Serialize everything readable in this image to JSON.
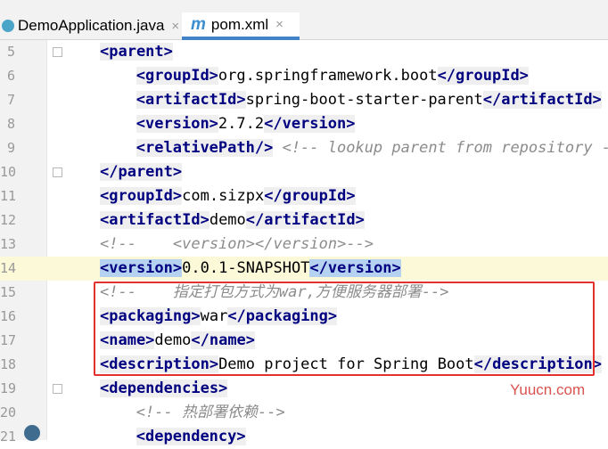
{
  "tabs": [
    {
      "label": "DemoApplication.java",
      "icon": "java-class-icon"
    },
    {
      "label": "pom.xml",
      "icon": "maven-icon",
      "active": true
    }
  ],
  "tab_close_glyph": "×",
  "maven_glyph": "m",
  "lines": [
    {
      "n": "5",
      "code": [
        [
          "t",
          "<parent>"
        ]
      ]
    },
    {
      "n": "6",
      "code": [
        [
          "t",
          "<groupId>"
        ],
        [
          "p",
          "org.springframework.boot"
        ],
        [
          "t",
          "</groupId>"
        ]
      ]
    },
    {
      "n": "7",
      "code": [
        [
          "t",
          "<artifactId>"
        ],
        [
          "p",
          "spring-boot-starter-parent"
        ],
        [
          "t",
          "</artifactId>"
        ]
      ]
    },
    {
      "n": "8",
      "code": [
        [
          "t",
          "<version>"
        ],
        [
          "p",
          "2.7.2"
        ],
        [
          "t",
          "</version>"
        ]
      ]
    },
    {
      "n": "9",
      "code": [
        [
          "t",
          "<relativePath/>"
        ],
        [
          "p",
          " "
        ],
        [
          "c",
          "<!-- lookup parent from repository -->"
        ]
      ]
    },
    {
      "n": "10",
      "code": [
        [
          "t",
          "</parent>"
        ]
      ]
    },
    {
      "n": "11",
      "code": [
        [
          "t",
          "<groupId>"
        ],
        [
          "p",
          "com.sizpx"
        ],
        [
          "t",
          "</groupId>"
        ]
      ]
    },
    {
      "n": "12",
      "code": [
        [
          "t",
          "<artifactId>"
        ],
        [
          "p",
          "demo"
        ],
        [
          "t",
          "</artifactId>"
        ]
      ]
    },
    {
      "n": "13",
      "code": [
        [
          "c",
          "<!--    <version></version>-->"
        ]
      ]
    },
    {
      "n": "14",
      "code": [
        [
          "t",
          "<version>"
        ],
        [
          "p",
          "0.0.1-SNAPSHOT"
        ],
        [
          "t",
          "</version>"
        ]
      ],
      "highlight": true
    },
    {
      "n": "15",
      "code": [
        [
          "c",
          "<!--    指定打包方式为war,方便服务器部署-->"
        ]
      ]
    },
    {
      "n": "16",
      "code": [
        [
          "t",
          "<packaging>"
        ],
        [
          "p",
          "war"
        ],
        [
          "t",
          "</packaging>"
        ]
      ]
    },
    {
      "n": "17",
      "code": [
        [
          "t",
          "<name>"
        ],
        [
          "p",
          "demo"
        ],
        [
          "t",
          "</name>"
        ]
      ]
    },
    {
      "n": "18",
      "code": [
        [
          "t",
          "<description>"
        ],
        [
          "p",
          "Demo project for Spring Boot"
        ],
        [
          "t",
          "</description>"
        ]
      ]
    },
    {
      "n": "19",
      "code": [
        [
          "t",
          "<dependencies>"
        ]
      ]
    },
    {
      "n": "20",
      "code": [
        [
          "c",
          "<!-- 热部署依赖-->"
        ]
      ]
    },
    {
      "n": "21",
      "code": [
        [
          "t",
          "<dependency>"
        ]
      ]
    }
  ],
  "watermark": "Yuucn.com",
  "colors": {
    "tag": "#000080",
    "comment": "#8c8c8c",
    "annotation_box": "#e53030",
    "current_line": "#fcf9d9"
  }
}
